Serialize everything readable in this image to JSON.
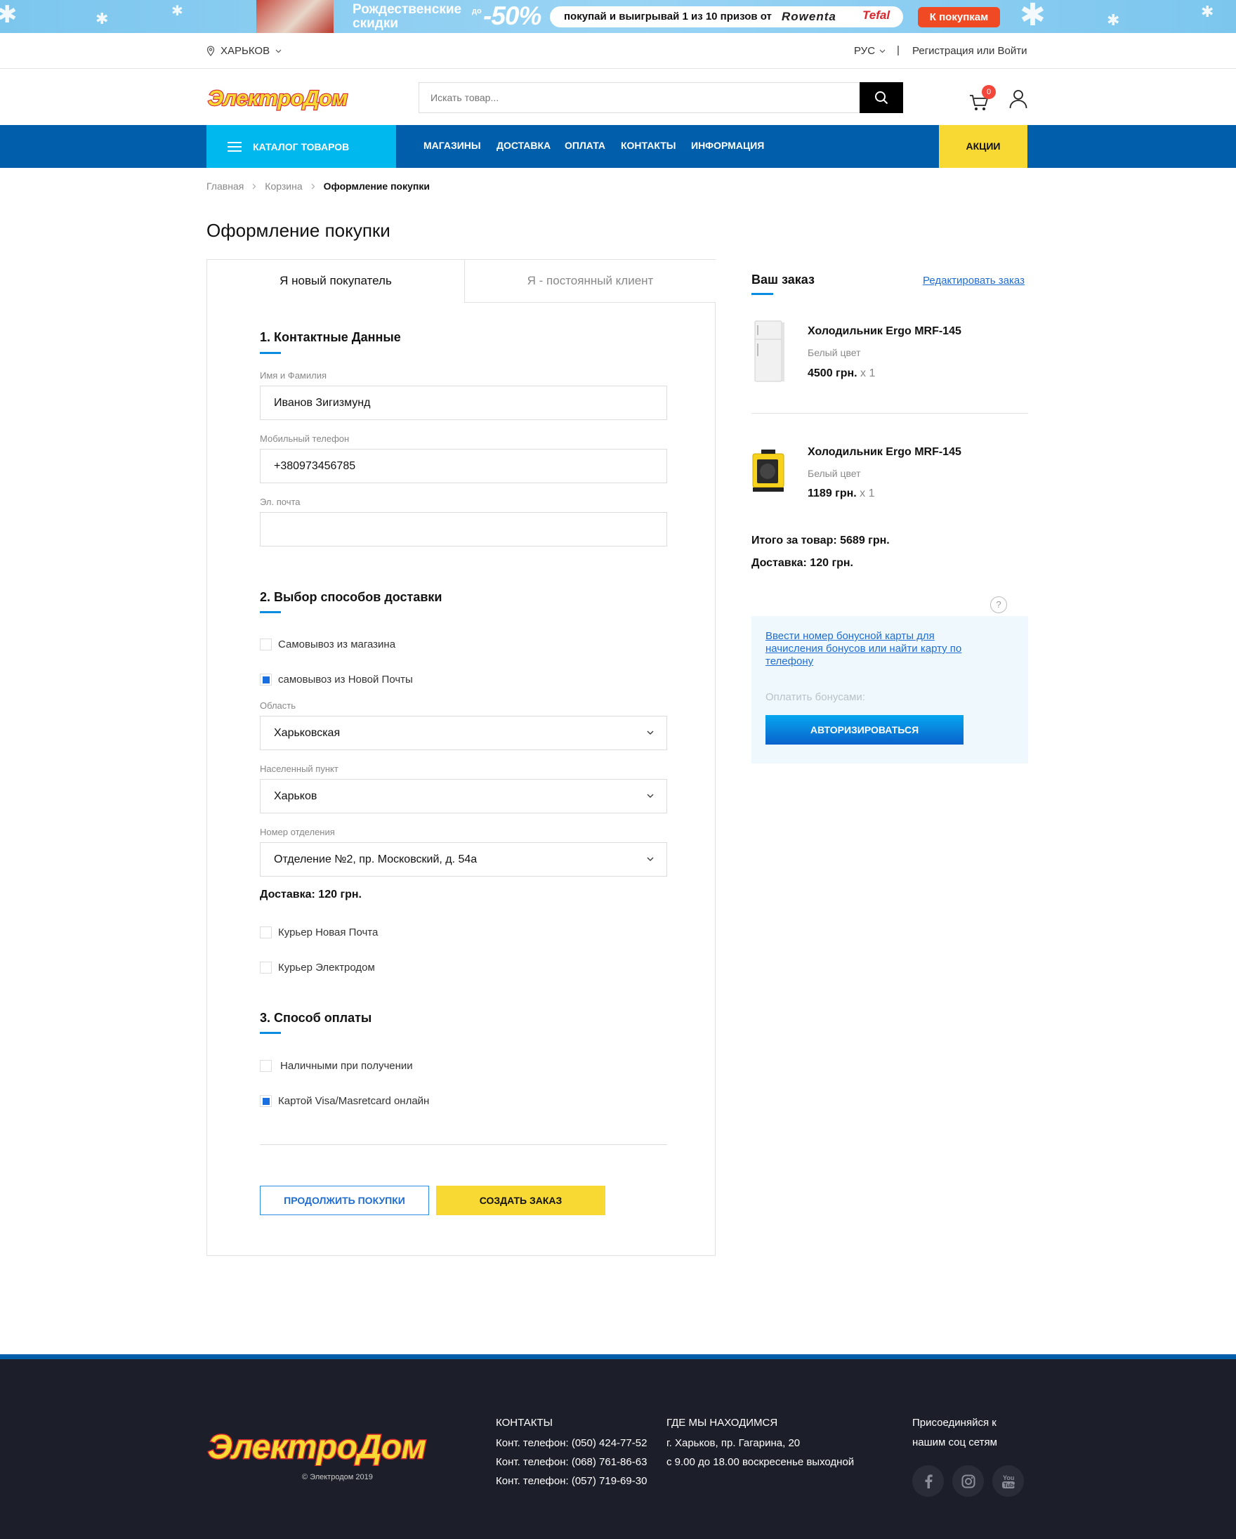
{
  "banner": {
    "title": "Рождественские скидки",
    "prefix": "до",
    "discount": "-50%",
    "promo_text": "покупай и выигрывай 1 из 10 призов от",
    "brand1": "Rowenta",
    "brand2": "Tefal",
    "cta": "К покупкам"
  },
  "utility": {
    "city": "ХАРЬКОВ",
    "lang": "РУС",
    "separator": "|",
    "login": "Регистрация или Войти"
  },
  "header": {
    "logo": "ЭлектроДом",
    "search_placeholder": "Искать товар...",
    "cart_count": "0"
  },
  "nav": {
    "catalog": "КАТАЛОГ ТОВАРОВ",
    "links": [
      "МАГАЗИНЫ",
      "ДОСТАВКА",
      "ОПЛАТА",
      "КОНТАКТЫ",
      "ИНФОРМАЦИЯ"
    ],
    "promo": "АКЦИИ"
  },
  "breadcrumb": {
    "items": [
      "Главная",
      "Корзина",
      "Оформление покупки"
    ]
  },
  "page_title": "Оформление покупки",
  "tabs": {
    "new": "Я новый покупатель",
    "returning": "Я - постоянный клиент"
  },
  "contact": {
    "title": "1. Контактные Данные",
    "name_label": "Имя и Фамилия",
    "name_value": "Иванов Зигизмунд",
    "phone_label": "Мобильный телефон",
    "phone_value": "+380973456785",
    "email_label": "Эл. почта",
    "email_value": ""
  },
  "delivery": {
    "title": "2. Выбор способов доставки",
    "option_pickup_store": "Самовывоз из магазина",
    "option_pickup_np": "самовывоз из Новой Почты",
    "region_label": "Область",
    "region_value": "Харьковская",
    "city_label": "Населенный пункт",
    "city_value": "Харьков",
    "branch_label": "Номер отделения",
    "branch_value": "Отделение №2, пр. Московский, д. 54а",
    "cost": "Доставка: 120 грн.",
    "option_courier_np": "Курьер Новая Почта",
    "option_courier_ed": "Курьер Электродом",
    "selected": "самовывоз из Новой Почты"
  },
  "payment": {
    "title": "3. Способ оплаты",
    "option_cash": "Наличными при получении",
    "option_card": "Картой Visa/Masretcard онлайн",
    "selected": "Картой Visa/Masretcard онлайн"
  },
  "actions": {
    "continue": "ПРОДОЛЖИТЬ ПОКУПКИ",
    "create": "СОЗДАТЬ ЗАКАЗ"
  },
  "order": {
    "title": "Ваш заказ",
    "edit": "Редактировать заказ",
    "items": [
      {
        "name": "Холодильник Ergo MRF-145",
        "color": "Белый цвет",
        "price": "4500 грн.",
        "qty": "x 1"
      },
      {
        "name": "Холодильник Ergo MRF-145",
        "color": "Белый цвет",
        "price": "1189 грн.",
        "qty": "x 1"
      }
    ],
    "total": "Итого за товар: 5689 грн.",
    "delivery": "Доставка: 120 грн."
  },
  "bonus": {
    "help": "?",
    "link": "Ввести номер бонусной карты для начисления бонусов или найти карту по телефону",
    "pay_label": "Оплатить бонусами:",
    "auth": "АВТОРИЗИРОВАТЬСЯ"
  },
  "footer": {
    "logo": "ЭлектроДом",
    "copyright": "© Элeктродом 2019",
    "contacts_title": "КОНТАКТЫ",
    "phones": [
      "Конт. телефон: (050) 424-77-52",
      "Конт. телефон: (068) 761-86-63",
      "Конт. телефон: (057) 719-69-30"
    ],
    "location_title": "ГДЕ МЫ НАХОДИМСЯ",
    "address": "г. Харьков, пр. Гагарина, 20",
    "hours": "с 9.00 до 18.00 воскресенье выходной",
    "social_title_1": "Присоединяйся к",
    "social_title_2": "нашим соц сетям",
    "social": [
      "facebook-icon",
      "instagram-icon",
      "youtube-icon"
    ]
  },
  "colors": {
    "nav_blue": "#005eab",
    "catalog_cyan": "#00b8ee",
    "accent_yellow": "#f8d934",
    "link_blue": "#1f6dd2",
    "footer_dark": "#1c1f2a",
    "badge_red": "#f2473a"
  }
}
